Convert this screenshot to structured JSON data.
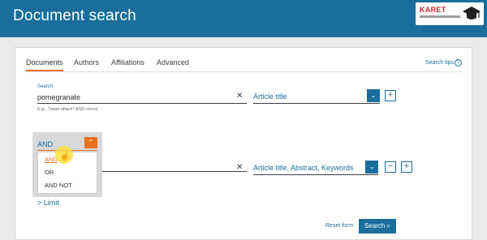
{
  "header": {
    "title": "Document search"
  },
  "logo": {
    "text": "KARET"
  },
  "tabs": [
    {
      "label": "Documents",
      "active": true
    },
    {
      "label": "Authors",
      "active": false
    },
    {
      "label": "Affiliations",
      "active": false
    },
    {
      "label": "Advanced",
      "active": false
    }
  ],
  "search_tips": {
    "label": "Search tips",
    "icon": "help-icon"
  },
  "row1": {
    "field_label": "Search",
    "value": "pomegranate",
    "hint": "E.g., \"heart attack\" AND stress",
    "field": "Article title"
  },
  "boolean_dropdown": {
    "selected": "AND",
    "options": [
      "AND",
      "OR",
      "AND NOT"
    ],
    "highlighted_index": 0
  },
  "row2": {
    "field": "Article title, Abstract, Keywords"
  },
  "limit": {
    "label": "> Limit"
  },
  "actions": {
    "reset": "Reset form",
    "search": "Search"
  },
  "colors": {
    "primary": "#1a6e9c",
    "accent": "#e9711c"
  }
}
